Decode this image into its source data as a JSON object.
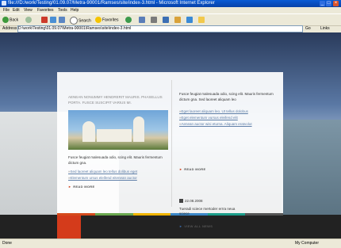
{
  "window": {
    "title": "file:///D:/work/Testing/01.09.07/Metra-90001/Ramses/site/index-3.html - Microsoft Internet Explorer"
  },
  "menu": [
    "File",
    "Edit",
    "View",
    "Favorites",
    "Tools",
    "Help"
  ],
  "toolbar": {
    "back": "Back",
    "search": "Search",
    "favorites": "Favorites"
  },
  "address": {
    "label": "Address",
    "value": "D:\\work\\Testing\\01.09.07\\Metra-90001\\Ramses\\site\\index-3.html",
    "go": "Go",
    "links": "Links"
  },
  "page": {
    "intro": "AENEAN NONUMMY HENDRERIT MAURIS. PHASELLUS PORTA. FUSCE SUSCIPIT VARIUS MI.",
    "left_text": "Fusce feugiat malesuada odio, scing elit. Mauris fermentum dictum gna.",
    "left_links": [
      "Sed laoreet aliquam leo tellus dolibus eget",
      "Elementum ursus eleifend eitenean auctor"
    ],
    "left_more": "READ MORE",
    "right_text": "Fusce feugiat malesuada odio, scing elit. Mauris fermentum dictum gna. Sed laoreet aliquam leo",
    "right_links": [
      "Eget laoreet aliquam leo. Ut tellus dolobus",
      "Eget elementum vursus eleifend elit",
      "Aenean auctor wisi eturna. Aliquam eratvolut"
    ],
    "right_more": "READ MORE",
    "news_date": "22.08.2008",
    "news_text": "Tueradi sciece mertoder errra neua sciece",
    "view_all": "VIEW ALL NEWS"
  },
  "status": {
    "left": "Done",
    "right": "My Computer"
  },
  "colors": {
    "footer_stripes": [
      "#d54a1c",
      "#6aa84f",
      "#f0b400",
      "#3b86c6",
      "#1c9d8a",
      "#555555"
    ]
  }
}
